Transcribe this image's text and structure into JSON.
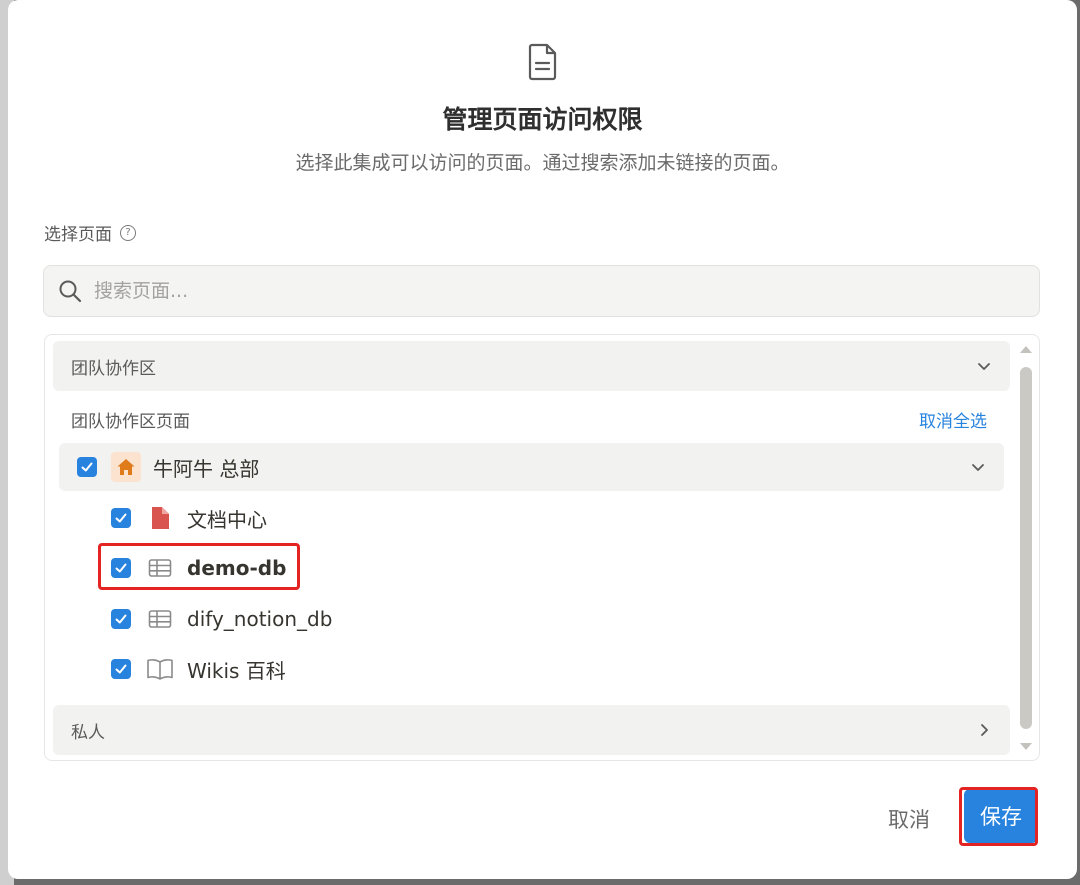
{
  "dialog": {
    "title": "管理页面访问权限",
    "subtitle": "选择此集成可以访问的页面。通过搜索添加未链接的页面。",
    "select_label": "选择页面",
    "help_icon": "question-circle-icon"
  },
  "search": {
    "placeholder": "搜索页面...",
    "value": ""
  },
  "sections": {
    "team": {
      "label": "团队协作区",
      "subhead": "团队协作区页面",
      "deselect_all": "取消全选",
      "parent": {
        "label": "牛阿牛 总部",
        "checked": true,
        "icon": "house-icon"
      },
      "children": [
        {
          "label": "文档中心",
          "checked": true,
          "icon": "document-icon"
        },
        {
          "label": "demo-db",
          "checked": true,
          "icon": "table-icon"
        },
        {
          "label": "dify_notion_db",
          "checked": true,
          "icon": "table-icon"
        },
        {
          "label": "Wikis 百科",
          "checked": true,
          "icon": "book-icon"
        }
      ]
    },
    "private": {
      "label": "私人"
    }
  },
  "footer": {
    "cancel": "取消",
    "save": "保存"
  },
  "colors": {
    "accent": "#2783de",
    "highlight": "#e42323",
    "house_icon": "#e07b1c",
    "doc_icon": "#d9534f"
  }
}
